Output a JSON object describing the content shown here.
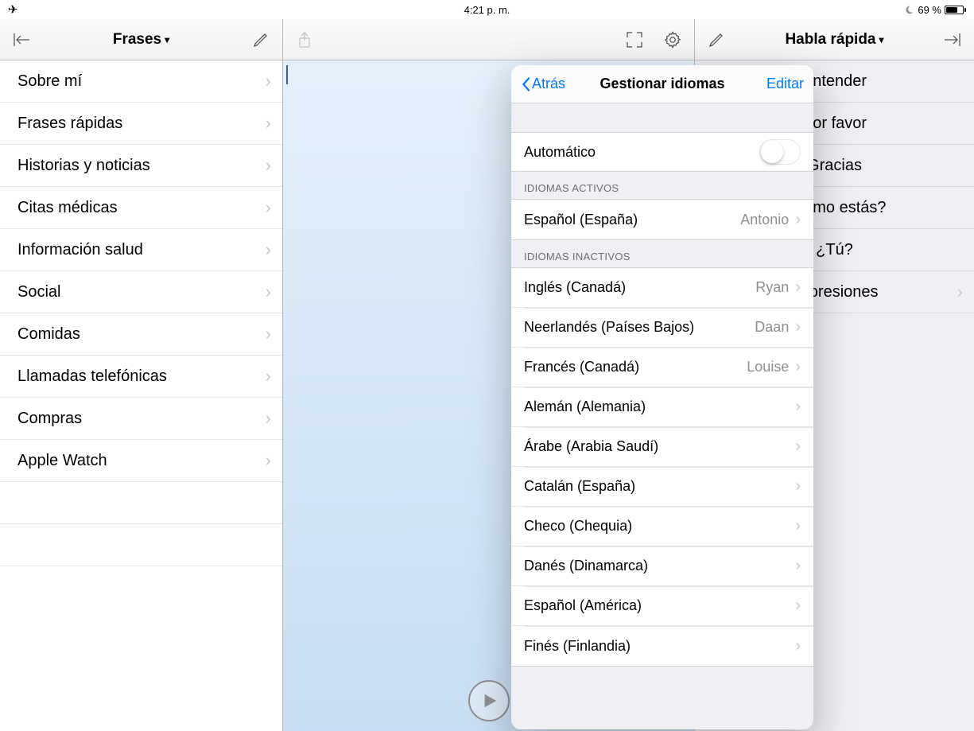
{
  "status": {
    "time": "4:21 p. m.",
    "battery_text": "69 %"
  },
  "left": {
    "title": "Frases",
    "items": [
      "Sobre mí",
      "Frases rápidas",
      "Historias y noticias",
      "Citas médicas",
      "Información salud",
      "Social",
      "Comidas",
      "Llamadas telefónicas",
      "Compras",
      "Apple Watch"
    ]
  },
  "right": {
    "title": "Habla rápida",
    "items": [
      {
        "label": "Entender",
        "chevron": false
      },
      {
        "label": "Por favor",
        "chevron": false
      },
      {
        "label": "Gracias",
        "chevron": false
      },
      {
        "label": "¿Cómo estás?",
        "chevron": false
      },
      {
        "label": "¿Tú?",
        "chevron": false
      },
      {
        "label": "Expresiones",
        "chevron": true
      }
    ]
  },
  "popover": {
    "back_label": "Atrás",
    "title": "Gestionar idiomas",
    "edit_label": "Editar",
    "auto_label": "Automático",
    "auto_on": false,
    "section_active": "IDIOMAS ACTIVOS",
    "active": [
      {
        "name": "Español (España)",
        "voice": "Antonio"
      }
    ],
    "section_inactive": "IDIOMAS INACTIVOS",
    "inactive": [
      {
        "name": "Inglés (Canadá)",
        "voice": "Ryan"
      },
      {
        "name": "Neerlandés (Países Bajos)",
        "voice": "Daan"
      },
      {
        "name": "Francés (Canadá)",
        "voice": "Louise"
      },
      {
        "name": "Alemán (Alemania)",
        "voice": ""
      },
      {
        "name": "Árabe (Arabia Saudí)",
        "voice": ""
      },
      {
        "name": "Catalán (España)",
        "voice": ""
      },
      {
        "name": "Checo (Chequia)",
        "voice": ""
      },
      {
        "name": "Danés (Dinamarca)",
        "voice": ""
      },
      {
        "name": "Español (América)",
        "voice": ""
      },
      {
        "name": "Finés (Finlandia)",
        "voice": ""
      }
    ]
  }
}
